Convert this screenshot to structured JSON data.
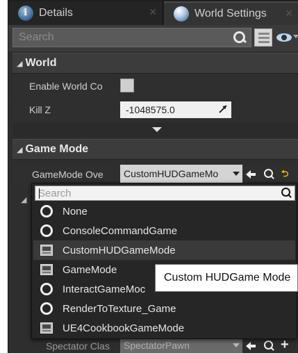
{
  "tabs": [
    {
      "label": "Details",
      "icon": "details-info-icon"
    },
    {
      "label": "World Settings",
      "icon": "world-globe-icon"
    }
  ],
  "search": {
    "placeholder": "Search"
  },
  "categories": {
    "world": "World",
    "game_mode": "Game Mode"
  },
  "world_props": {
    "enable_world_label": "Enable World Co",
    "kill_z_label": "Kill Z",
    "kill_z_value": "-1048575.0"
  },
  "game_mode": {
    "override_label": "GameMode Ove",
    "override_value": "CustomHUDGameMo"
  },
  "picker": {
    "search_placeholder": "Search",
    "options": [
      {
        "label": "None",
        "icon": "class-ring-icon",
        "selected": false
      },
      {
        "label": "ConsoleCommandGame",
        "icon": "class-ring-icon",
        "selected": false
      },
      {
        "label": "CustomHUDGameMode",
        "icon": "blueprint-icon",
        "selected": true
      },
      {
        "label": "GameMode",
        "icon": "blueprint-icon",
        "selected": false
      },
      {
        "label": "InteractGameMoc",
        "icon": "class-ring-icon",
        "selected": false
      },
      {
        "label": "RenderToTexture_Game",
        "icon": "class-ring-icon",
        "selected": false
      },
      {
        "label": "UE4CookbookGameMode",
        "icon": "blueprint-icon",
        "selected": false
      }
    ]
  },
  "tooltip": "Custom HUDGame Mode",
  "spectator": {
    "label": "Spectator Clas",
    "value": "SpectatorPawn"
  }
}
